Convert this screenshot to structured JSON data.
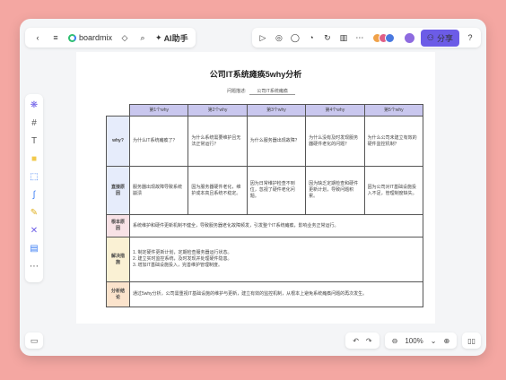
{
  "header": {
    "brand": "boardmix",
    "ai_label": "AI助手",
    "share_label": "分享"
  },
  "doc": {
    "title": "公司IT系统瘫痪5why分析",
    "meta_label": "问题描述:",
    "meta_value": "公司IT系统瘫痪"
  },
  "table": {
    "headers": [
      "",
      "第1个why",
      "第2个why",
      "第3个why",
      "第4个why",
      "第5个why"
    ],
    "why_row": {
      "label": "why?",
      "cells": [
        "为什么IT系统瘫痪了？",
        "为什么系统需要维护且无法正常运行？",
        "为什么服务器出现故障？",
        "为什么没有及时发现服务器硬件老化的问题？",
        "为什么公司未建立有效的硬件监控机制？"
      ]
    },
    "answer_row": {
      "label": "直接原因",
      "cells": [
        "服务器出现故障导致系统崩溃",
        "因为服务器硬件老化，维护成本高且系统不稳定。",
        "因为日常维护检查不到位，忽视了硬件老化问题。",
        "因为缺乏定期检查和硬件更新计划，导致问题积累。",
        "因为公司对IT基础设施投入不足，管理制度缺失。"
      ]
    },
    "root_cause": {
      "label": "根本原因",
      "text": "系统维护和硬件更新机制不健全，导致服务器老化故障频发，引发整个IT系统瘫痪，影响业务正常运行。"
    },
    "solution": {
      "label": "解决措施",
      "lines": [
        "1. 制定硬件更新计划，定期检查服务器运行状态。",
        "2. 建立实时监控系统，及时发现并处理硬件隐患。",
        "3. 增加IT基础设施投入，完善维护管理制度。"
      ]
    },
    "summary": {
      "label": "分析结论",
      "text": "通过5why分析，公司需重视IT基础设施的维护与更新，建立有效的监控机制，从根本上避免系统瘫痪问题的再次发生。"
    }
  },
  "zoom": {
    "level": "100%"
  }
}
